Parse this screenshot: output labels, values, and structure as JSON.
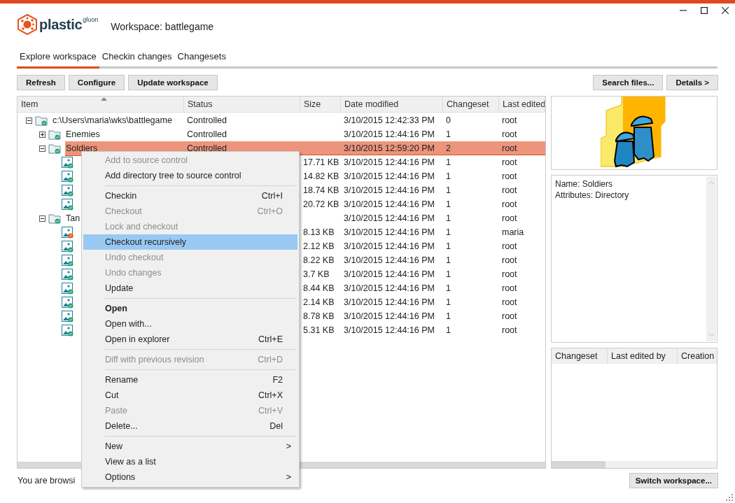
{
  "app": {
    "brand": "plastic",
    "brand_suffix": "gluon",
    "workspace_title": "Workspace: battlegame"
  },
  "tabs": [
    {
      "label": "Explore workspace",
      "selected": true
    },
    {
      "label": "Checkin changes",
      "selected": false
    },
    {
      "label": "Changesets",
      "selected": false
    }
  ],
  "toolbar_left": [
    "Refresh",
    "Configure",
    "Update workspace"
  ],
  "toolbar_right": [
    "Search files...",
    "Details >"
  ],
  "table": {
    "columns": [
      "Item",
      "Status",
      "Size",
      "Date modified",
      "Changeset",
      "Last edited"
    ],
    "rows": [
      {
        "kind": "folder",
        "name": "c:\\Users\\maria\\wks\\battlegame",
        "status": "Controlled",
        "date": "3/10/2015 12:42:33 PM",
        "changeset": "0",
        "user": "root",
        "expanded": true,
        "selected": false,
        "children": [
          {
            "kind": "folder",
            "name": "Enemies",
            "status": "Controlled",
            "date": "3/10/2015 12:44:16 PM",
            "changeset": "1",
            "user": "root",
            "expanded": false,
            "selected": false
          },
          {
            "kind": "folder",
            "name": "Soldiers",
            "status": "Controlled",
            "date": "3/10/2015 12:59:20 PM",
            "changeset": "2",
            "user": "root",
            "expanded": true,
            "selected": true,
            "children": [
              {
                "kind": "file",
                "size": "17.71 KB",
                "date": "3/10/2015 12:44:16 PM",
                "changeset": "1",
                "user": "root",
                "selected": false,
                "changed": false
              },
              {
                "kind": "file",
                "size": "14.82 KB",
                "date": "3/10/2015 12:44:16 PM",
                "changeset": "1",
                "user": "root",
                "selected": false,
                "changed": false
              },
              {
                "kind": "file",
                "size": "18.74 KB",
                "date": "3/10/2015 12:44:16 PM",
                "changeset": "1",
                "user": "root",
                "selected": false,
                "changed": false
              },
              {
                "kind": "file",
                "size": "20.72 KB",
                "date": "3/10/2015 12:44:16 PM",
                "changeset": "1",
                "user": "root",
                "selected": false,
                "changed": false
              }
            ]
          },
          {
            "kind": "folder",
            "name": "Tan",
            "date": "3/10/2015 12:44:16 PM",
            "changeset": "1",
            "user": "root",
            "expanded": true,
            "selected": false,
            "children": [
              {
                "kind": "file",
                "size": "8.13 KB",
                "date": "3/10/2015 12:44:16 PM",
                "changeset": "1",
                "user": "maria",
                "selected": false,
                "changed": true
              },
              {
                "kind": "file",
                "size": "2.12 KB",
                "date": "3/10/2015 12:44:16 PM",
                "changeset": "1",
                "user": "root",
                "selected": false,
                "changed": false
              },
              {
                "kind": "file",
                "size": "8.22 KB",
                "date": "3/10/2015 12:44:16 PM",
                "changeset": "1",
                "user": "root",
                "selected": false,
                "changed": false
              },
              {
                "kind": "file",
                "size": "3.7 KB",
                "date": "3/10/2015 12:44:16 PM",
                "changeset": "1",
                "user": "root",
                "selected": false,
                "changed": false
              },
              {
                "kind": "file",
                "size": "8.44 KB",
                "date": "3/10/2015 12:44:16 PM",
                "changeset": "1",
                "user": "root",
                "selected": false,
                "changed": false
              },
              {
                "kind": "file",
                "size": "2.14 KB",
                "date": "3/10/2015 12:44:16 PM",
                "changeset": "1",
                "user": "root",
                "selected": false,
                "changed": false
              },
              {
                "kind": "file",
                "size": "8.78 KB",
                "date": "3/10/2015 12:44:16 PM",
                "changeset": "1",
                "user": "root",
                "selected": false,
                "changed": false
              },
              {
                "kind": "file",
                "size": "5.31 KB",
                "date": "3/10/2015 12:44:16 PM",
                "changeset": "1",
                "user": "root",
                "selected": false,
                "changed": false
              }
            ]
          }
        ]
      }
    ]
  },
  "details": {
    "lines": [
      "Name: Soldiers",
      "Attributes: Directory"
    ]
  },
  "history": {
    "columns": [
      "Changeset",
      "Last edited by",
      "Creation"
    ]
  },
  "status_bar": {
    "text": "You are browsi",
    "button": "Switch workspace..."
  },
  "context_menu": [
    {
      "kind": "item",
      "label": "Add to source control",
      "disabled": true,
      "selected": false,
      "bold": false
    },
    {
      "kind": "item",
      "label": "Add directory tree to source control",
      "disabled": false,
      "selected": false,
      "bold": false
    },
    {
      "kind": "separator"
    },
    {
      "kind": "item",
      "label": "Checkin",
      "shortcut": "Ctrl+I",
      "disabled": false,
      "selected": false,
      "bold": false
    },
    {
      "kind": "item",
      "label": "Checkout",
      "shortcut": "Ctrl+O",
      "disabled": true,
      "selected": false,
      "bold": false
    },
    {
      "kind": "item",
      "label": "Lock and checkout",
      "disabled": true,
      "selected": false,
      "bold": false
    },
    {
      "kind": "item",
      "label": "Checkout recursively",
      "disabled": false,
      "selected": true,
      "bold": false
    },
    {
      "kind": "item",
      "label": "Undo checkout",
      "disabled": true,
      "selected": false,
      "bold": false
    },
    {
      "kind": "item",
      "label": "Undo changes",
      "disabled": true,
      "selected": false,
      "bold": false
    },
    {
      "kind": "item",
      "label": "Update",
      "disabled": false,
      "selected": false,
      "bold": false
    },
    {
      "kind": "separator"
    },
    {
      "kind": "item",
      "label": "Open",
      "disabled": false,
      "selected": false,
      "bold": true
    },
    {
      "kind": "item",
      "label": "Open with...",
      "disabled": false,
      "selected": false,
      "bold": false
    },
    {
      "kind": "item",
      "label": "Open in explorer",
      "shortcut": "Ctrl+E",
      "disabled": false,
      "selected": false,
      "bold": false
    },
    {
      "kind": "separator"
    },
    {
      "kind": "item",
      "label": "Diff with previous revision",
      "shortcut": "Ctrl+D",
      "disabled": true,
      "selected": false,
      "bold": false
    },
    {
      "kind": "separator"
    },
    {
      "kind": "item",
      "label": "Rename",
      "shortcut": "F2",
      "disabled": false,
      "selected": false,
      "bold": false
    },
    {
      "kind": "item",
      "label": "Cut",
      "shortcut": "Ctrl+X",
      "disabled": false,
      "selected": false,
      "bold": false
    },
    {
      "kind": "item",
      "label": "Paste",
      "shortcut": "Ctrl+V",
      "disabled": true,
      "selected": false,
      "bold": false
    },
    {
      "kind": "item",
      "label": "Delete...",
      "shortcut": "Del",
      "disabled": false,
      "selected": false,
      "bold": false
    },
    {
      "kind": "separator"
    },
    {
      "kind": "item",
      "label": "New",
      "arrow": ">",
      "disabled": false,
      "selected": false,
      "bold": false
    },
    {
      "kind": "item",
      "label": "View as a list",
      "disabled": false,
      "selected": false,
      "bold": false
    },
    {
      "kind": "item",
      "label": "Options",
      "arrow": ">",
      "disabled": false,
      "selected": false,
      "bold": false
    }
  ]
}
